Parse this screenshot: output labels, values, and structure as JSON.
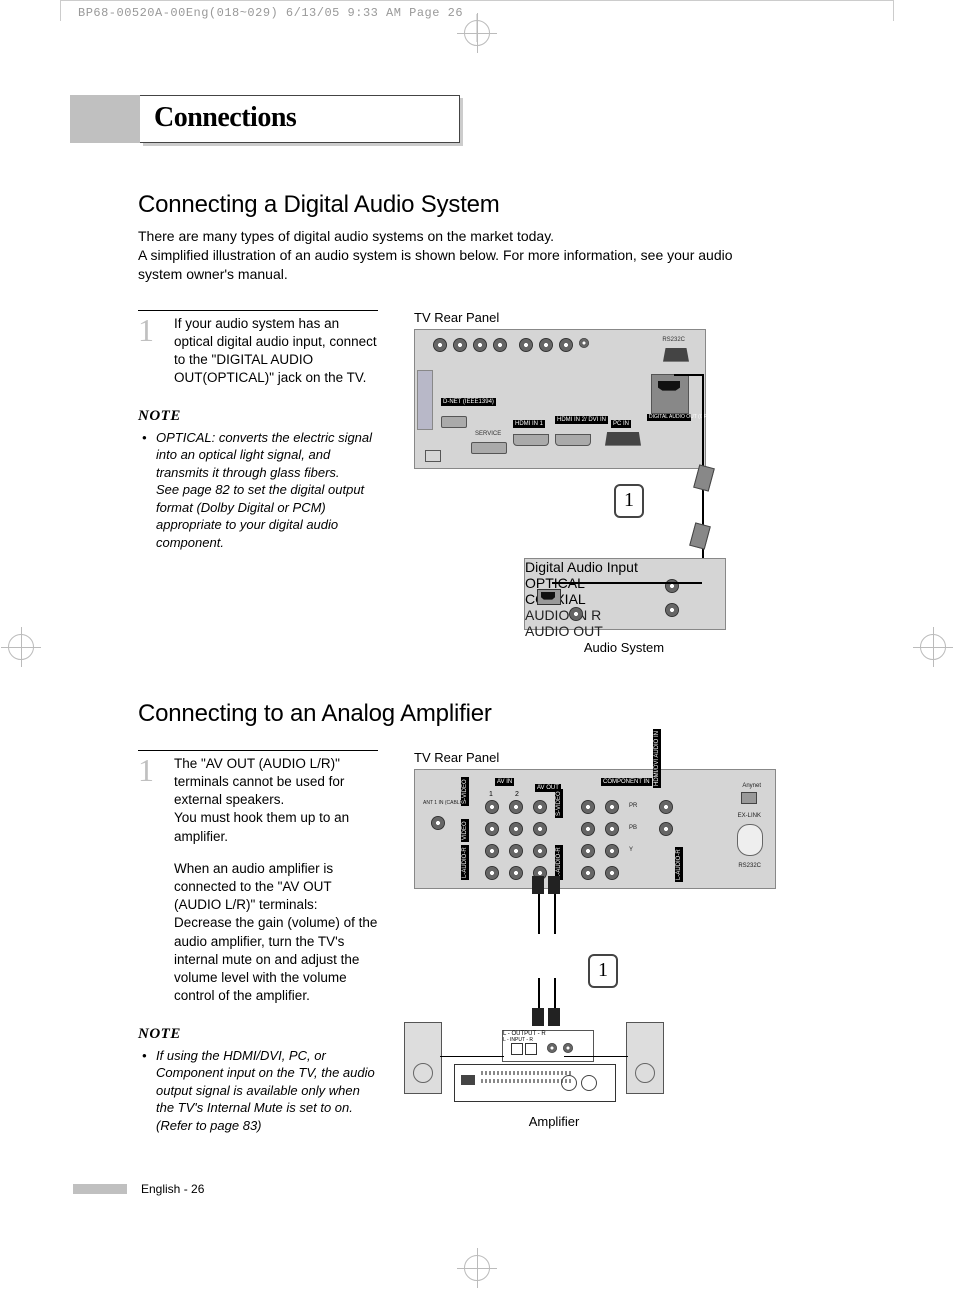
{
  "header_strip": "BP68-00520A-00Eng(018~029)  6/13/05  9:33 AM  Page 26",
  "page_title": "Connections",
  "section1": {
    "title": "Connecting a Digital Audio System",
    "intro_line1": "There are many types of digital audio systems on the market today.",
    "intro_line2": "A simplified illustration of an audio system is shown below. For more information, see your audio system owner's manual.",
    "step_number": "1",
    "step_text": "If your audio system has an optical digital audio input, connect to the \"DIGITAL AUDIO OUT(OPTICAL)\" jack on the TV.",
    "note_label": "NOTE",
    "note_text": "OPTICAL: converts the electric signal into an optical light signal, and transmits it through glass fibers.\nSee page 82 to set the digital output format (Dolby Digital or PCM) appropriate to your digital audio component.",
    "panel_top_label": "TV Rear Panel",
    "panel_bottom_label": "Audio System",
    "badge": "1",
    "ports": {
      "rs232c": "RS232C",
      "digital_audio_out": "DIGITAL AUDIO OUT (OPTICAL)",
      "service": "SERVICE",
      "dnet": "D-NET (IEEE1394)",
      "hdmi1": "HDMI IN 1",
      "hdmi2": "HDMI IN 2/ DVI IN",
      "pcin": "PC IN"
    },
    "audio_box": {
      "header": "Digital Audio Input",
      "optical": "OPTICAL",
      "coaxial": "COAXIAL",
      "audio_in_r": "AUDIO IN R",
      "audio_out": "AUDIO OUT"
    }
  },
  "section2": {
    "title": "Connecting to an Analog Amplifier",
    "step_number": "1",
    "step_text_p1": "The \"AV OUT (AUDIO L/R)\" terminals cannot be used for external speakers.\nYou must hook them up to an amplifier.",
    "step_text_p2": "When an audio amplifier is connected to the \"AV OUT (AUDIO L/R)\" terminals: Decrease the gain (volume) of the audio amplifier, turn the TV's internal mute on and adjust the volume level with the volume control of the amplifier.",
    "note_label": "NOTE",
    "note_text": "If using the HDMI/DVI, PC, or Component input on the TV, the audio output signal is available only when the TV's Internal Mute is set to on.\n(Refer to page 83)",
    "panel_top_label": "TV Rear Panel",
    "panel_bottom_label": "Amplifier",
    "badge": "1",
    "ports": {
      "ant1": "ANT 1 IN (CABLE)",
      "avin": "AV IN",
      "avin1": "1",
      "avin2": "2",
      "avout": "AV OUT",
      "video": "VIDEO",
      "svideo_l": "S-VIDEO",
      "svideo_r": "S-VIDEO",
      "l_audio_r": "L-AUDIO-R",
      "hdmi_dvi_audio": "HDMI/DVI AUDIO IN",
      "component1": "COMPONENT IN",
      "pr": "PR",
      "pb": "PB",
      "y": "Y",
      "anynet": "Anynet",
      "exlink": "EX-LINK",
      "rs232c": "RS232C"
    },
    "amp": {
      "output": "L - OUTPUT - R",
      "input": "L - INPUT - R"
    }
  },
  "footer": "English - 26"
}
